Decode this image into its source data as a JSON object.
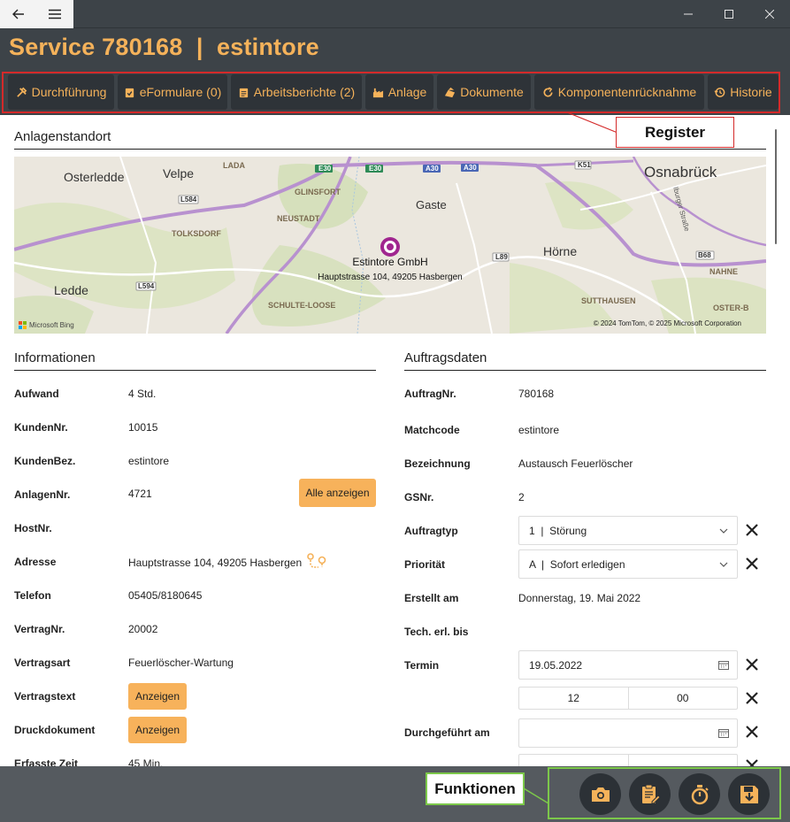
{
  "window": {
    "back_icon": "arrow-left-icon",
    "menu_icon": "hamburger-icon"
  },
  "header": {
    "title": "Service 780168  |  estintore"
  },
  "tabs": [
    {
      "label": "Durchführung",
      "icon": "tools-icon"
    },
    {
      "label": "eFormulare (0)",
      "icon": "clipboard-check-icon"
    },
    {
      "label": "Arbeitsberichte (2)",
      "icon": "clipboard-list-icon"
    },
    {
      "label": "Anlage",
      "icon": "factory-icon"
    },
    {
      "label": "Dokumente",
      "icon": "documents-icon"
    },
    {
      "label": "Komponentenrücknahme",
      "icon": "refresh-icon"
    },
    {
      "label": "Historie",
      "icon": "history-icon"
    }
  ],
  "callouts": {
    "register": "Register",
    "funktionen": "Funktionen"
  },
  "standort": {
    "title": "Anlagenstandort",
    "map": {
      "pin_name": "Estintore GmbH",
      "pin_address": "Hauptstrasse 104, 49205 Hasbergen",
      "attribution": "© 2024 TomTom, © 2025 Microsoft Corporation",
      "brand": "Microsoft Bing",
      "places": [
        "Osterledde",
        "Velpe",
        "LADA",
        "GLINSFORT",
        "NEUSTADT",
        "Gaste",
        "Osnabrück",
        "TOLKSDORF",
        "Hörne",
        "Ledde",
        "SCHULTE-LOOSE",
        "SUTTHAUSEN",
        "NAHNE",
        "OSTER-B",
        "Iburger Straße"
      ],
      "roads": [
        "E30",
        "E30",
        "A30",
        "A30",
        "K51",
        "L584",
        "L89",
        "L594",
        "B68"
      ]
    }
  },
  "informationen": {
    "title": "Informationen",
    "rows": [
      {
        "label": "Aufwand",
        "value": "4 Std."
      },
      {
        "label": "KundenNr.",
        "value": "10015"
      },
      {
        "label": "KundenBez.",
        "value": "estintore"
      },
      {
        "label": "AnlagenNr.",
        "value": "4721"
      },
      {
        "label": "HostNr.",
        "value": ""
      },
      {
        "label": "Adresse",
        "value": "Hauptstrasse 104, 49205 Hasbergen"
      },
      {
        "label": "Telefon",
        "value": "05405/8180645"
      },
      {
        "label": "VertragNr.",
        "value": "20002"
      },
      {
        "label": "Vertragsart",
        "value": "Feuerlöscher-Wartung"
      },
      {
        "label": "Vertragstext",
        "value": ""
      },
      {
        "label": "Druckdokument",
        "value": ""
      },
      {
        "label": "Erfasste Zeit",
        "value": "45 Min."
      }
    ],
    "alle_anzeigen": "Alle anzeigen",
    "anzeigen": "Anzeigen",
    "route_icon": "route-icon"
  },
  "auftragsdaten": {
    "title": "Auftragsdaten",
    "rows": [
      {
        "label": "AuftragNr.",
        "value": "780168"
      },
      {
        "label": "Matchcode",
        "value": "estintore"
      },
      {
        "label": "Bezeichnung",
        "value": "Austausch Feuerlöscher"
      },
      {
        "label": "GSNr.",
        "value": "2"
      },
      {
        "label": "Auftragtyp",
        "value": "1  |  Störung"
      },
      {
        "label": "Priorität",
        "value": "A  |  Sofort erledigen"
      },
      {
        "label": "Erstellt am",
        "value": "Donnerstag, 19. Mai 2022"
      },
      {
        "label": "Tech. erl. bis",
        "value": ""
      },
      {
        "label": "Termin",
        "value": "19.05.2022"
      },
      {
        "label": "Termin Stunde",
        "value": "12"
      },
      {
        "label": "Termin Minute",
        "value": "00"
      },
      {
        "label": "Durchgeführt am",
        "value": ""
      }
    ]
  },
  "functions": [
    {
      "name": "camera",
      "icon": "camera-icon"
    },
    {
      "name": "report",
      "icon": "clipboard-edit-icon"
    },
    {
      "name": "timer",
      "icon": "stopwatch-icon"
    },
    {
      "name": "save",
      "icon": "save-download-icon"
    }
  ],
  "colors": {
    "accent": "#f5b25a",
    "header_bg": "#3d4348",
    "tab_bg": "#2e3338",
    "register_outline": "#d42a2a",
    "functions_outline": "#7cc84a",
    "button_orange": "#f7b25b"
  }
}
